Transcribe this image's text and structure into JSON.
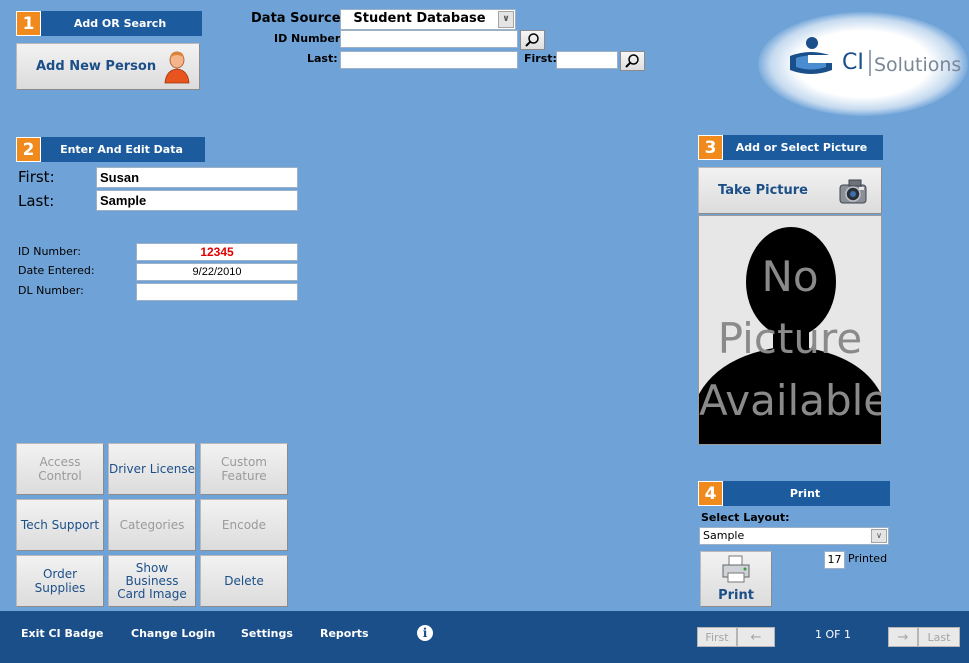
{
  "section1": {
    "num": "1",
    "title": "Add OR Search"
  },
  "add_person": {
    "label": "Add New Person"
  },
  "search": {
    "data_source_label": "Data Source:",
    "data_source_value": "Student Database",
    "id_label": "ID Number:",
    "id_value": "",
    "last_label": "Last:",
    "last_value": "",
    "first_label": "First:",
    "first_value": ""
  },
  "logo": {
    "text_ci": "CI",
    "text_solutions": "Solutions"
  },
  "section2": {
    "num": "2",
    "title": "Enter And Edit Data"
  },
  "person": {
    "first_label": "First:",
    "first_value": "Susan",
    "last_label": "Last:",
    "last_value": "Sample",
    "id_label": "ID Number:",
    "id_value": "12345",
    "date_label": "Date Entered:",
    "date_value": "9/22/2010",
    "dl_label": "DL Number:",
    "dl_value": ""
  },
  "section3": {
    "num": "3",
    "title": "Add or Select Picture"
  },
  "take_picture": {
    "label": "Take Picture"
  },
  "no_picture": {
    "line1": "No",
    "line2": "Picture",
    "line3": "Available"
  },
  "actions": {
    "access_control": "Access Control",
    "driver_license": "Driver License",
    "custom_feature": "Custom Feature",
    "tech_support": "Tech Support",
    "categories": "Categories",
    "encode": "Encode",
    "order_supplies": "Order Supplies",
    "show_business_card_line1": "Show Business",
    "show_business_card_line2": "Card Image",
    "delete": "Delete"
  },
  "section4": {
    "num": "4",
    "title": "Print"
  },
  "print": {
    "select_layout_label": "Select Layout:",
    "layout_value": "Sample",
    "printed_count": "17",
    "printed_label": "Printed",
    "print_button": "Print"
  },
  "bottom": {
    "exit": "Exit CI Badge",
    "change_login": "Change Login",
    "settings": "Settings",
    "reports": "Reports",
    "first": "First",
    "last": "Last",
    "record_current": "1",
    "record_of": "OF",
    "record_total": "1"
  },
  "colors": {
    "background": "#6fa3d8",
    "header_bar": "#1c5c9e",
    "section_number": "#f08a1c",
    "bottom_bar": "#1b4f8a",
    "id_value_text": "#e00000"
  }
}
